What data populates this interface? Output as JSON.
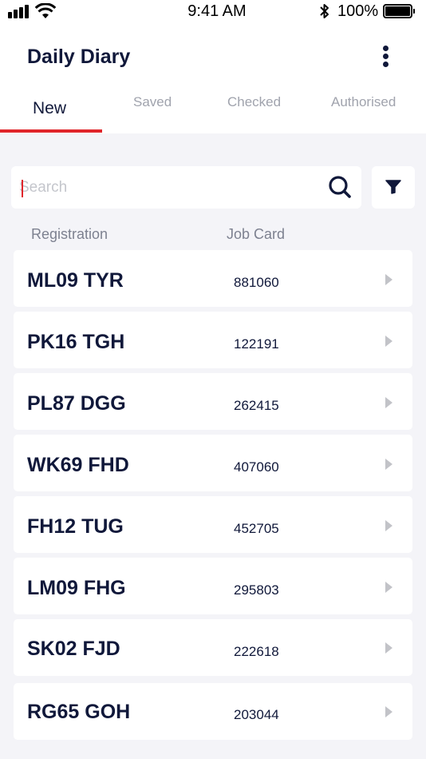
{
  "status_bar": {
    "time": "9:41 AM",
    "battery_percent": "100%",
    "icons": [
      "signal-icon",
      "wifi-icon",
      "bluetooth-icon",
      "battery-icon"
    ]
  },
  "header": {
    "title": "Daily Diary",
    "menu_icon": "more-vertical-icon"
  },
  "tabs": [
    {
      "label": "New",
      "active": true
    },
    {
      "label": "Saved",
      "active": false
    },
    {
      "label": "Checked",
      "active": false
    },
    {
      "label": "Authorised",
      "active": false
    }
  ],
  "search": {
    "placeholder": "Search",
    "value": "",
    "icon": "search-icon",
    "filter_icon": "filter-icon"
  },
  "columns": {
    "registration": "Registration",
    "job_card": "Job Card"
  },
  "rows": [
    {
      "registration": "ML09 TYR",
      "job_card": "881060"
    },
    {
      "registration": "PK16 TGH",
      "job_card": "122191"
    },
    {
      "registration": "PL87 DGG",
      "job_card": "262415"
    },
    {
      "registration": "WK69 FHD",
      "job_card": "407060"
    },
    {
      "registration": "FH12 TUG",
      "job_card": "452705"
    },
    {
      "registration": "LM09 FHG",
      "job_card": "295803"
    },
    {
      "registration": "SK02 FJD",
      "job_card": "222618"
    },
    {
      "registration": "RG65 GOH",
      "job_card": "203044"
    }
  ],
  "colors": {
    "accent": "#e0252b",
    "text_primary": "#10183a",
    "background": "#f4f4f8"
  }
}
